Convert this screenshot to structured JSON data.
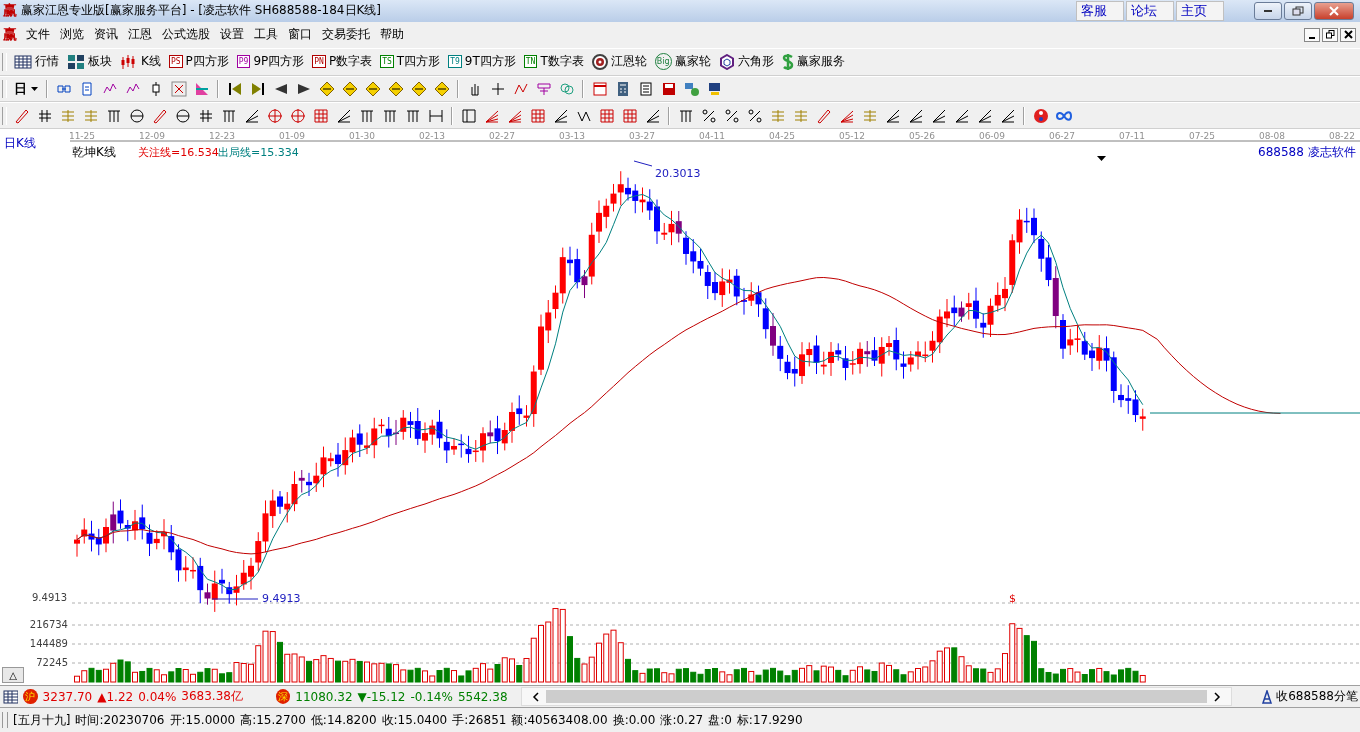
{
  "window": {
    "logo": "赢",
    "title": "赢家江恩专业版[赢家服务平台] - [凌志软件  SH688588-184日K线]",
    "links": [
      "客服",
      "论坛",
      "主页"
    ]
  },
  "menu": {
    "logo": "赢",
    "items": [
      "文件",
      "浏览",
      "资讯",
      "江恩",
      "公式选股",
      "设置",
      "工具",
      "窗口",
      "交易委托",
      "帮助"
    ]
  },
  "toolbar": [
    {
      "kind": "table",
      "label": "行情"
    },
    {
      "kind": "blocks",
      "label": "板块"
    },
    {
      "kind": "candles",
      "label": "K线"
    },
    {
      "kind": "badge",
      "badge": "PS",
      "label": "P四方形",
      "color": "#b00000"
    },
    {
      "kind": "badge",
      "badge": "P9",
      "label": "9P四方形",
      "color": "#a000a0"
    },
    {
      "kind": "badge",
      "badge": "PN",
      "label": "P数字表",
      "color": "#b00000"
    },
    {
      "kind": "badge",
      "badge": "TS",
      "label": "T四方形",
      "color": "#008000"
    },
    {
      "kind": "badge",
      "badge": "T9",
      "label": "9T四方形",
      "color": "#008080"
    },
    {
      "kind": "badge",
      "badge": "TN",
      "label": "T数字表",
      "color": "#008000"
    },
    {
      "kind": "target",
      "label": "江恩轮"
    },
    {
      "kind": "wheel",
      "badge": "Big",
      "label": "赢家轮"
    },
    {
      "kind": "hexagon",
      "label": "六角形"
    },
    {
      "kind": "dollar",
      "label": "赢家服务"
    }
  ],
  "period_button": "日",
  "chart": {
    "period": "日K线",
    "indicator": "乾坤K线",
    "watch_line": "关注线=16.534",
    "exit_line": "出局线=15.334",
    "code": "688588",
    "name": "凌志软件",
    "dates": [
      "11-25",
      "12-09",
      "12-23",
      "01-09",
      "01-30",
      "02-13",
      "02-27",
      "03-13",
      "03-27",
      "04-11",
      "04-25",
      "05-12",
      "05-26",
      "06-09",
      "06-27",
      "07-11",
      "07-25",
      "08-08",
      "08-22"
    ],
    "high_label": "20.3013",
    "low_label": "9.4913",
    "price_axis": "9.4913",
    "signal_mark": "$",
    "volume_axis": [
      "216734",
      "144489",
      "72245"
    ],
    "collapse_button": "△"
  },
  "index_bar": {
    "sh": {
      "badge": "沪",
      "values": [
        "3237.70",
        "▲1.22",
        "0.04%",
        "3683.38亿"
      ]
    },
    "sz": {
      "badge": "深",
      "values": [
        "11080.32",
        "▼-15.12",
        "-0.14%",
        "5542.38"
      ]
    },
    "tick_link": "收688588分笔"
  },
  "status": [
    "[五月十九]",
    "时间:20230706",
    "开:15.0000",
    "高:15.2700",
    "低:14.8200",
    "收:15.0400",
    "手:26851",
    "额:40563408.00",
    "换:0.00",
    "涨:0.27",
    "盘:0",
    "标:17.9290"
  ]
}
